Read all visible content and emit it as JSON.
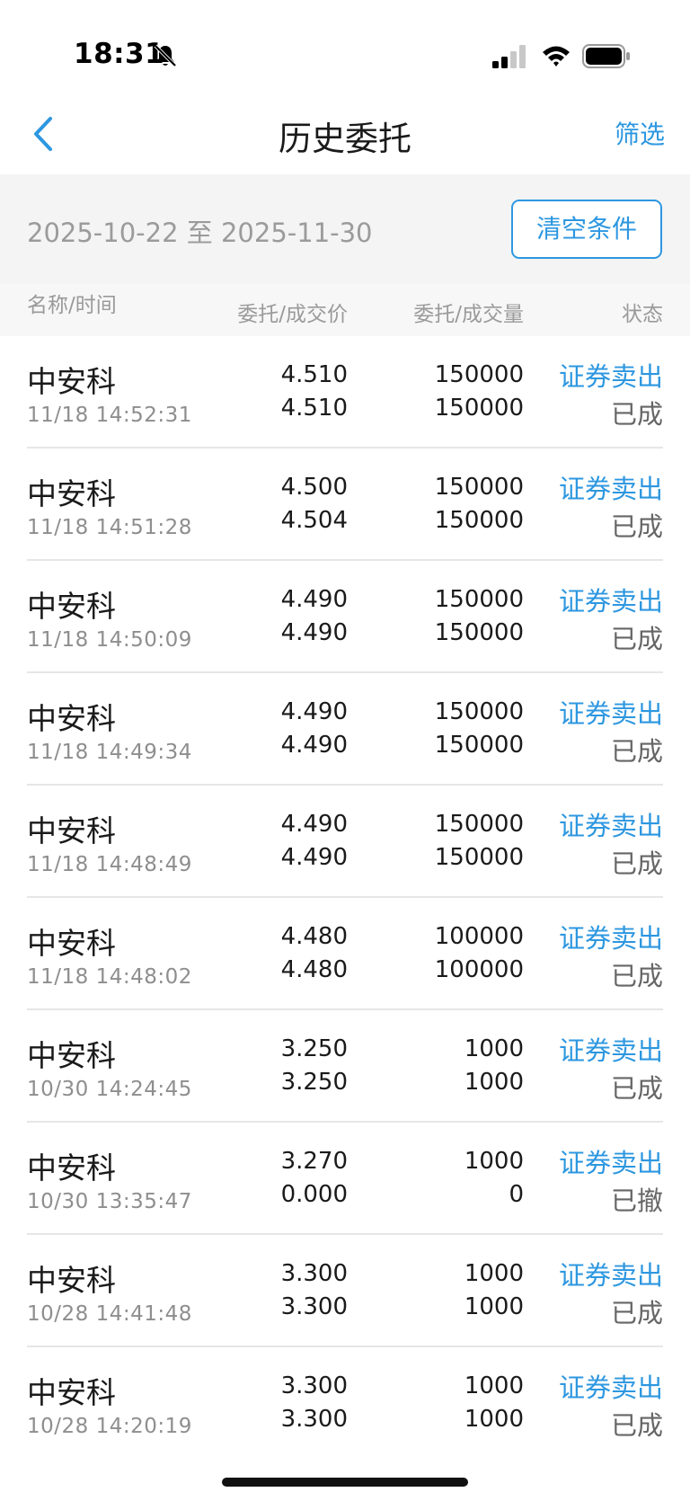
{
  "status_bar": {
    "time": "18:31"
  },
  "nav": {
    "title": "历史委托",
    "filter_label": "筛选"
  },
  "filter_bar": {
    "date_range": "2025-10-22 至 2025-11-30",
    "clear_label": "清空条件"
  },
  "table": {
    "headers": {
      "name_time": "名称/时间",
      "price": "委托/成交价",
      "volume": "委托/成交量",
      "status": "状态"
    },
    "rows": [
      {
        "name": "中安科",
        "time": "11/18 14:52:31",
        "order_price": "4.510",
        "deal_price": "4.510",
        "order_qty": "150000",
        "deal_qty": "150000",
        "op": "证券卖出",
        "status": "已成"
      },
      {
        "name": "中安科",
        "time": "11/18 14:51:28",
        "order_price": "4.500",
        "deal_price": "4.504",
        "order_qty": "150000",
        "deal_qty": "150000",
        "op": "证券卖出",
        "status": "已成"
      },
      {
        "name": "中安科",
        "time": "11/18 14:50:09",
        "order_price": "4.490",
        "deal_price": "4.490",
        "order_qty": "150000",
        "deal_qty": "150000",
        "op": "证券卖出",
        "status": "已成"
      },
      {
        "name": "中安科",
        "time": "11/18 14:49:34",
        "order_price": "4.490",
        "deal_price": "4.490",
        "order_qty": "150000",
        "deal_qty": "150000",
        "op": "证券卖出",
        "status": "已成"
      },
      {
        "name": "中安科",
        "time": "11/18 14:48:49",
        "order_price": "4.490",
        "deal_price": "4.490",
        "order_qty": "150000",
        "deal_qty": "150000",
        "op": "证券卖出",
        "status": "已成"
      },
      {
        "name": "中安科",
        "time": "11/18 14:48:02",
        "order_price": "4.480",
        "deal_price": "4.480",
        "order_qty": "100000",
        "deal_qty": "100000",
        "op": "证券卖出",
        "status": "已成"
      },
      {
        "name": "中安科",
        "time": "10/30 14:24:45",
        "order_price": "3.250",
        "deal_price": "3.250",
        "order_qty": "1000",
        "deal_qty": "1000",
        "op": "证券卖出",
        "status": "已成"
      },
      {
        "name": "中安科",
        "time": "10/30 13:35:47",
        "order_price": "3.270",
        "deal_price": "0.000",
        "order_qty": "1000",
        "deal_qty": "0",
        "op": "证券卖出",
        "status": "已撤"
      },
      {
        "name": "中安科",
        "time": "10/28 14:41:48",
        "order_price": "3.300",
        "deal_price": "3.300",
        "order_qty": "1000",
        "deal_qty": "1000",
        "op": "证券卖出",
        "status": "已成"
      },
      {
        "name": "中安科",
        "time": "10/28 14:20:19",
        "order_price": "3.300",
        "deal_price": "3.300",
        "order_qty": "1000",
        "deal_qty": "1000",
        "op": "证券卖出",
        "status": "已成"
      }
    ]
  },
  "colors": {
    "accent": "#2d97e0",
    "muted_text": "#8e8e8e",
    "divider": "#e6e6e6",
    "filter_bg": "#f4f4f4"
  },
  "icons": {
    "back": "chevron-left-icon",
    "bell": "bell-slash-icon",
    "signal": "cellular-signal-icon",
    "wifi": "wifi-icon",
    "battery": "battery-icon"
  }
}
